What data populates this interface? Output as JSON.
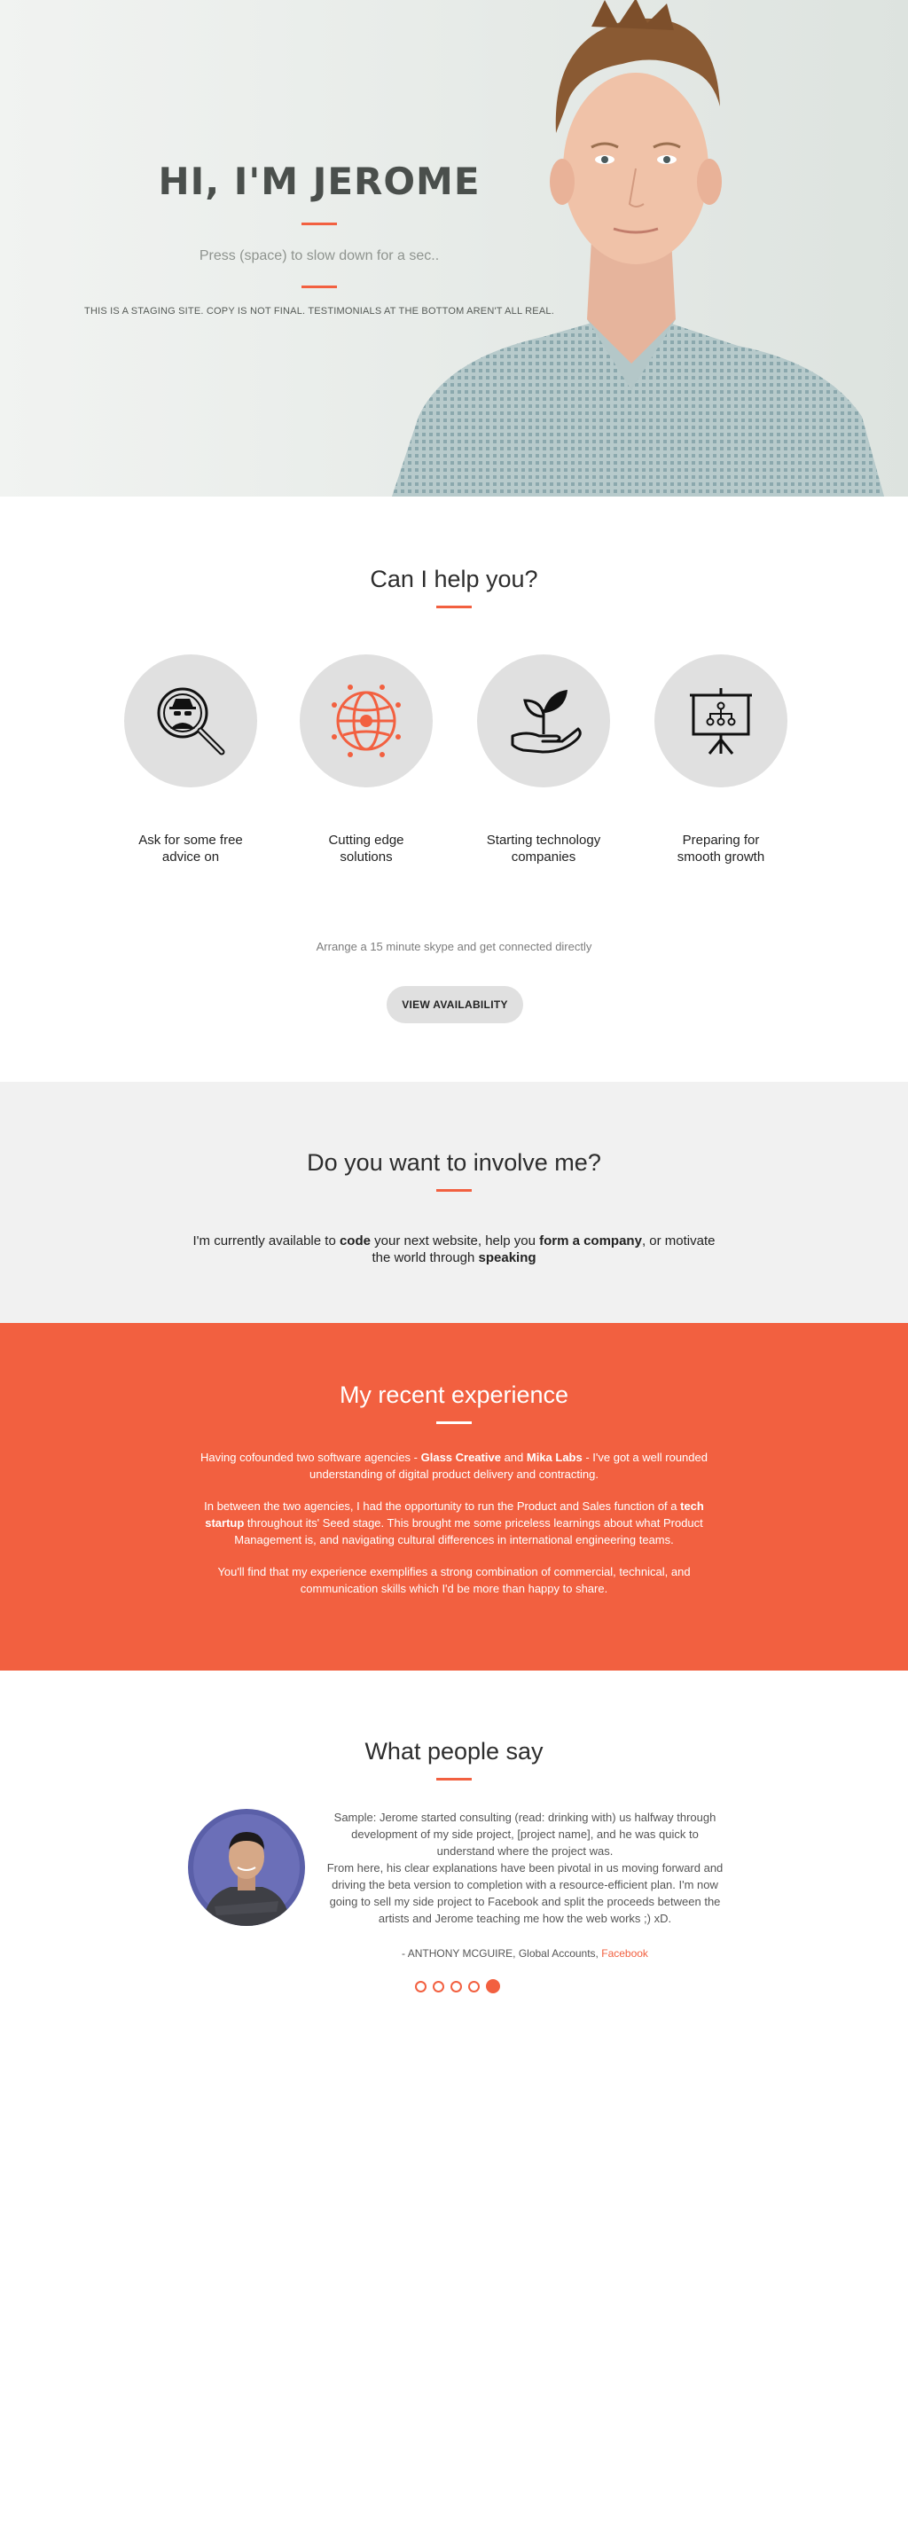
{
  "hero": {
    "title": "HI, I'M JEROME",
    "subtitle": "Press (space) to slow down for a sec..",
    "note": "THIS IS A STAGING SITE. COPY IS NOT FINAL. TESTIMONIALS AT THE BOTTOM AREN'T ALL REAL."
  },
  "help": {
    "title": "Can I help you?",
    "services": [
      {
        "label": "Ask for some free advice on",
        "icon": "spy-magnifier-icon"
      },
      {
        "label": "Cutting edge solutions",
        "icon": "globe-network-icon"
      },
      {
        "label": "Starting technology companies",
        "icon": "hand-sprout-icon"
      },
      {
        "label": "Preparing for smooth growth",
        "icon": "presentation-board-icon"
      }
    ],
    "arrange_text": "Arrange a 15 minute skype and get connected directly",
    "button_label": "VIEW AVAILABILITY"
  },
  "involve": {
    "title": "Do you want to involve me?",
    "t1": "I'm currently available to ",
    "b1": "code",
    "t2": " your next website, help you ",
    "b2": "form a company",
    "t3": ", or motivate the world through ",
    "b3": "speaking"
  },
  "experience": {
    "title": "My recent experience",
    "p1a": "Having cofounded two software agencies - ",
    "p1b": "Glass Creative",
    "p1c": " and ",
    "p1d": "Mika Labs",
    "p1e": " - I've got a well rounded understanding of digital product delivery and contracting.",
    "p2a": "In between the two agencies, I had the opportunity to run the Product and Sales function of a ",
    "p2b": "tech startup",
    "p2c": " throughout its' Seed stage. This brought me some priceless learnings about what Product Management is, and navigating cultural differences in international engineering teams.",
    "p3": "You'll find that my experience exemplifies a strong combination of commercial, technical, and communication skills which I'd be more than happy to share."
  },
  "testimonials": {
    "title": "What people say",
    "quote_p1": "Sample: Jerome started consulting (read: drinking with) us halfway through development of my side project, [project name], and he was quick to understand where the project was.",
    "quote_p2": "From here, his clear explanations have been pivotal in us moving forward and driving the beta version to completion with a resource-efficient plan. I'm now going to sell my side project to Facebook and split the proceeds between the artists and Jerome teaching me how the web works ;) xD.",
    "author": "- ANTHONY MCGUIRE, Global Accounts, ",
    "company": "Facebook",
    "active_slide": 5,
    "slide_count": 5
  },
  "colors": {
    "accent": "#f26040",
    "circle": "#e0e0e0",
    "section_gray": "#f1f1f1"
  }
}
